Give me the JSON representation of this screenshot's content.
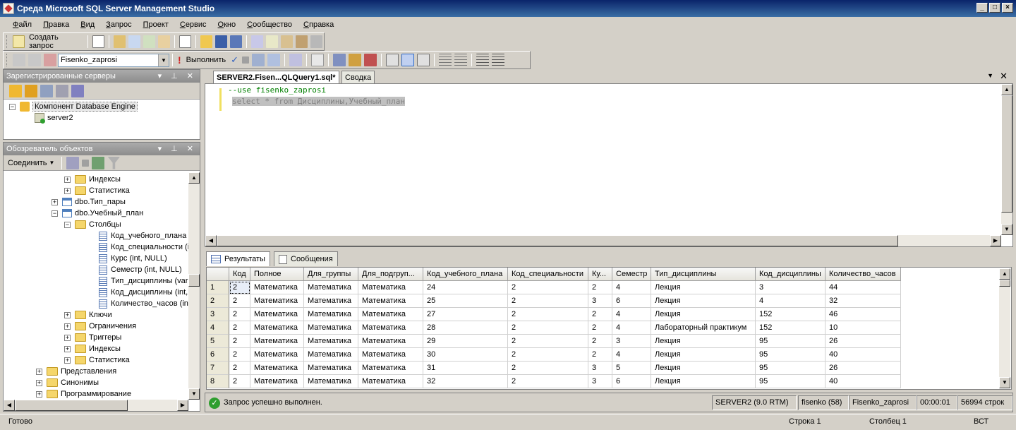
{
  "window": {
    "title": "Среда Microsoft SQL Server Management Studio"
  },
  "menu": [
    "Файл",
    "Правка",
    "Вид",
    "Запрос",
    "Проект",
    "Сервис",
    "Окно",
    "Сообщество",
    "Справка"
  ],
  "toolbar1": {
    "new_query": "Создать запрос"
  },
  "toolbar2": {
    "database": "Fisenko_zaprosi",
    "execute": "Выполнить"
  },
  "registered_servers": {
    "title": "Зарегистрированные серверы",
    "root": "Компонент Database Engine",
    "child": "server2"
  },
  "object_explorer": {
    "title": "Обозреватель объектов",
    "connect": "Соединить",
    "tree": [
      {
        "label": "Индексы",
        "kind": "folder",
        "level": 3,
        "exp": "+"
      },
      {
        "label": "Статистика",
        "kind": "folder",
        "level": 3,
        "exp": "+"
      },
      {
        "label": "dbo.Тип_пары",
        "kind": "table",
        "level": 2,
        "exp": "+"
      },
      {
        "label": "dbo.Учебный_план",
        "kind": "table",
        "level": 2,
        "exp": "−"
      },
      {
        "label": "Столбцы",
        "kind": "folder",
        "level": 3,
        "exp": "−"
      },
      {
        "label": "Код_учебного_плана (",
        "kind": "column",
        "level": 4
      },
      {
        "label": "Код_специальности (in",
        "kind": "column",
        "level": 4
      },
      {
        "label": "Курс (int, NULL)",
        "kind": "column",
        "level": 4
      },
      {
        "label": "Семестр (int, NULL)",
        "kind": "column",
        "level": 4
      },
      {
        "label": "Тип_дисциплины (varc",
        "kind": "column",
        "level": 4
      },
      {
        "label": "Код_дисциплины (int,",
        "kind": "column",
        "level": 4
      },
      {
        "label": "Количество_часов (int",
        "kind": "column",
        "level": 4
      },
      {
        "label": "Ключи",
        "kind": "folder",
        "level": 3,
        "exp": "+"
      },
      {
        "label": "Ограничения",
        "kind": "folder",
        "level": 3,
        "exp": "+"
      },
      {
        "label": "Триггеры",
        "kind": "folder",
        "level": 3,
        "exp": "+"
      },
      {
        "label": "Индексы",
        "kind": "folder",
        "level": 3,
        "exp": "+"
      },
      {
        "label": "Статистика",
        "kind": "folder",
        "level": 3,
        "exp": "+"
      },
      {
        "label": "Представления",
        "kind": "folder",
        "level": 1,
        "exp": "+"
      },
      {
        "label": "Синонимы",
        "kind": "folder",
        "level": 1,
        "exp": "+"
      },
      {
        "label": "Программирование",
        "kind": "folder",
        "level": 1,
        "exp": "+"
      }
    ]
  },
  "editor": {
    "tabs": [
      "SERVER2.Fisen...QLQuery1.sql*",
      "Сводка"
    ],
    "lines": [
      "--use fisenko_zaprosi",
      "select * from Дисциплины,Учебный_план"
    ]
  },
  "results": {
    "tabs": [
      "Результаты",
      "Сообщения"
    ],
    "columns": [
      "Код",
      "Полное",
      "Для_группы",
      "Для_подгруп...",
      "Код_учебного_плана",
      "Код_специальности",
      "Ку...",
      "Семестр",
      "Тип_дисциплины",
      "Код_дисциплины",
      "Количество_часов"
    ],
    "rows": [
      [
        "1",
        "2",
        "Математика",
        "Математика",
        "Математика",
        "24",
        "2",
        "2",
        "4",
        "Лекция",
        "3",
        "44"
      ],
      [
        "2",
        "2",
        "Математика",
        "Математика",
        "Математика",
        "25",
        "2",
        "3",
        "6",
        "Лекция",
        "4",
        "32"
      ],
      [
        "3",
        "2",
        "Математика",
        "Математика",
        "Математика",
        "27",
        "2",
        "2",
        "4",
        "Лекция",
        "152",
        "46"
      ],
      [
        "4",
        "2",
        "Математика",
        "Математика",
        "Математика",
        "28",
        "2",
        "2",
        "4",
        "Лабораторный практикум",
        "152",
        "10"
      ],
      [
        "5",
        "2",
        "Математика",
        "Математика",
        "Математика",
        "29",
        "2",
        "2",
        "3",
        "Лекция",
        "95",
        "26"
      ],
      [
        "6",
        "2",
        "Математика",
        "Математика",
        "Математика",
        "30",
        "2",
        "2",
        "4",
        "Лекция",
        "95",
        "40"
      ],
      [
        "7",
        "2",
        "Математика",
        "Математика",
        "Математика",
        "31",
        "2",
        "3",
        "5",
        "Лекция",
        "95",
        "26"
      ],
      [
        "8",
        "2",
        "Математика",
        "Математика",
        "Математика",
        "32",
        "2",
        "3",
        "6",
        "Лекция",
        "95",
        "40"
      ]
    ]
  },
  "query_status": {
    "message": "Запрос успешно выполнен.",
    "server": "SERVER2 (9.0 RTM)",
    "user": "fisenko (58)",
    "database": "Fisenko_zaprosi",
    "time": "00:00:01",
    "rows": "56994 строк"
  },
  "statusbar": {
    "ready": "Готово",
    "line": "Строка 1",
    "col": "Столбец 1",
    "mode": "ВСТ"
  },
  "colors": {
    "title_bar": "#0a246a",
    "panel_title": "#9c9c9c",
    "comment": "#008000",
    "success": "#2e9e2e"
  }
}
